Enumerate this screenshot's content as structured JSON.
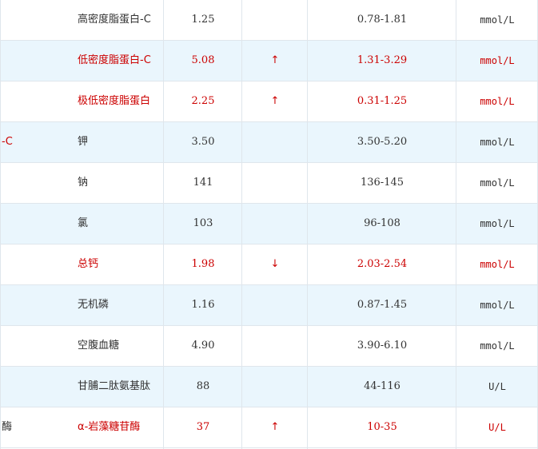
{
  "rows": [
    {
      "left": "",
      "name": "高密度脂蛋白-C",
      "value": "1.25",
      "flag": "",
      "range": "0.78-1.81",
      "unit": "mmol/L",
      "abnormal": false
    },
    {
      "left": "",
      "name": "低密度脂蛋白-C",
      "value": "5.08",
      "flag": "↑",
      "range": "1.31-3.29",
      "unit": "mmol/L",
      "abnormal": true
    },
    {
      "left": "",
      "name": "极低密度脂蛋白",
      "value": "2.25",
      "flag": "↑",
      "range": "0.31-1.25",
      "unit": "mmol/L",
      "abnormal": true
    },
    {
      "left": "-C",
      "name": "钾",
      "value": "3.50",
      "flag": "",
      "range": "3.50-5.20",
      "unit": "mmol/L",
      "abnormal": false
    },
    {
      "left": "",
      "name": "钠",
      "value": "141",
      "flag": "",
      "range": "136-145",
      "unit": "mmol/L",
      "abnormal": false
    },
    {
      "left": "",
      "name": "氯",
      "value": "103",
      "flag": "",
      "range": "96-108",
      "unit": "mmol/L",
      "abnormal": false
    },
    {
      "left": "",
      "name": "总钙",
      "value": "1.98",
      "flag": "↓",
      "range": "2.03-2.54",
      "unit": "mmol/L",
      "abnormal": true
    },
    {
      "left": "",
      "name": "无机磷",
      "value": "1.16",
      "flag": "",
      "range": "0.87-1.45",
      "unit": "mmol/L",
      "abnormal": false
    },
    {
      "left": "",
      "name": "空腹血糖",
      "value": "4.90",
      "flag": "",
      "range": "3.90-6.10",
      "unit": "mmol/L",
      "abnormal": false
    },
    {
      "left": "",
      "name": "甘脯二肽氨基肽",
      "value": "88",
      "flag": "",
      "range": "44-116",
      "unit": "U/L",
      "abnormal": false
    },
    {
      "left": "酶",
      "name": "α-岩藻糖苷酶",
      "value": "37",
      "flag": "↑",
      "range": "10-35",
      "unit": "U/L",
      "abnormal": true
    }
  ],
  "colors": {
    "abnormal": "#cc0000",
    "normal": "#333333",
    "row_alt": "#eaf6fd",
    "grid": "#dfe6ec"
  }
}
